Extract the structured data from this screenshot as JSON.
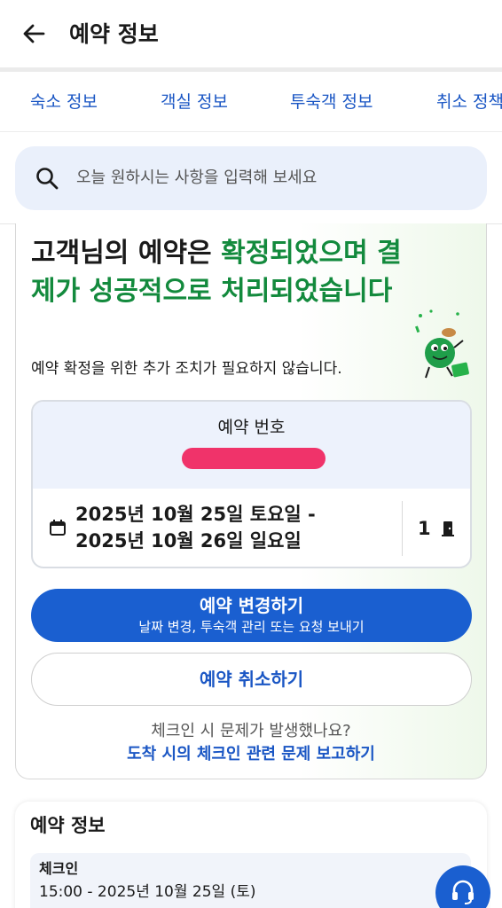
{
  "header": {
    "title": "예약 정보",
    "back_icon": "arrow-left-icon"
  },
  "tabs": [
    {
      "label": "숙소 정보"
    },
    {
      "label": "객실 정보"
    },
    {
      "label": "투숙객 정보"
    },
    {
      "label": "취소 정책"
    }
  ],
  "search": {
    "placeholder": "오늘 원하시는 사항을 입력해 보세요",
    "icon": "search-icon"
  },
  "confirmation": {
    "headline_part1": "고객님의 예약은 ",
    "headline_part2": "확정되었으며 결제가 성공적으로 처리되었습니다",
    "subline": "예약 확정을 위한 추가 조치가 필요하지 않습니다.",
    "booking_label": "예약 번호",
    "date_line1": "2025년 10월 25일 토요일 -",
    "date_line2": "2025년 10월 26일 일요일",
    "room_count": "1",
    "primary_button": "예약 변경하기",
    "primary_button_sub": "날짜 변경, 투숙객 관리 또는 요청 보내기",
    "cancel_button": "예약 취소하기",
    "issue_question": "체크인 시 문제가 발생했나요?",
    "issue_link": "도착 시의 체크인 관련 문제 보고하기"
  },
  "info": {
    "title": "예약 정보",
    "checkin_label": "체크인",
    "checkin_value": "15:00 - 2025년 10월 25일 (토)"
  },
  "colors": {
    "accent": "#1a5fd0",
    "success": "#138a3d",
    "link": "#1a56c4"
  }
}
